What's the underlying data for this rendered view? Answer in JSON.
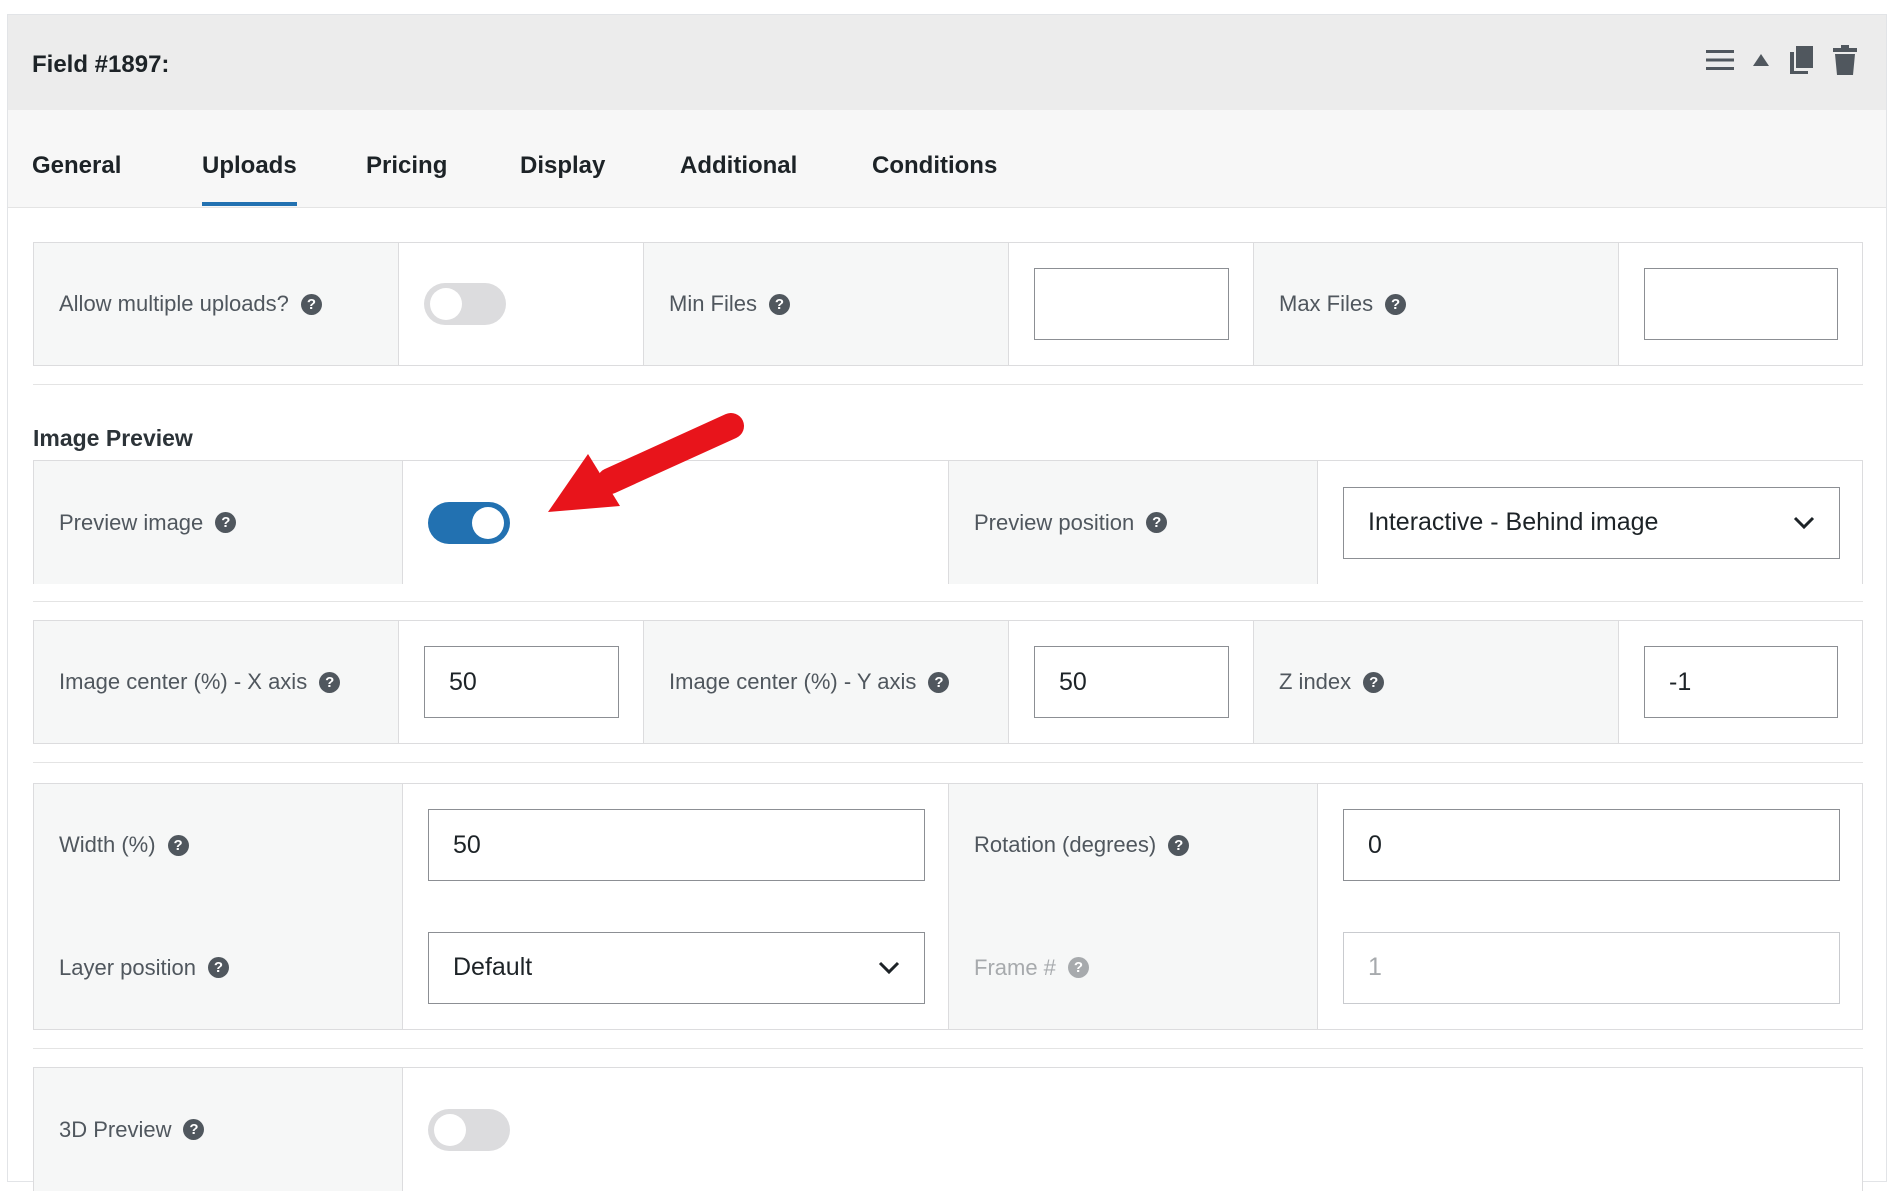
{
  "header": {
    "title": "Field #1897:"
  },
  "tabs": [
    {
      "label": "General"
    },
    {
      "label": "Uploads"
    },
    {
      "label": "Pricing"
    },
    {
      "label": "Display"
    },
    {
      "label": "Additional"
    },
    {
      "label": "Conditions"
    }
  ],
  "active_tab": "Uploads",
  "uploads": {
    "allow_multiple_label": "Allow multiple uploads?",
    "allow_multiple_on": false,
    "min_files_label": "Min Files",
    "min_files_value": "",
    "max_files_label": "Max Files",
    "max_files_value": ""
  },
  "image_preview": {
    "section_title": "Image Preview",
    "preview_image_label": "Preview image",
    "preview_image_on": true,
    "preview_position_label": "Preview position",
    "preview_position_value": "Interactive - Behind image",
    "center_x_label": "Image center (%) - X axis",
    "center_x_value": "50",
    "center_y_label": "Image center (%) - Y axis",
    "center_y_value": "50",
    "z_index_label": "Z index",
    "z_index_value": "-1",
    "width_label": "Width (%)",
    "width_value": "50",
    "rotation_label": "Rotation (degrees)",
    "rotation_value": "0",
    "layer_position_label": "Layer position",
    "layer_position_value": "Default",
    "frame_label": "Frame #",
    "frame_value": "1",
    "preview_3d_label": "3D Preview",
    "preview_3d_on": false
  },
  "help_glyph": "?",
  "colors": {
    "accent": "#2271b1",
    "annotation_arrow": "#e8141b"
  },
  "icons": [
    "menu-icon",
    "collapse-up-icon",
    "duplicate-icon",
    "trash-icon",
    "chevron-down-icon",
    "help-icon"
  ]
}
